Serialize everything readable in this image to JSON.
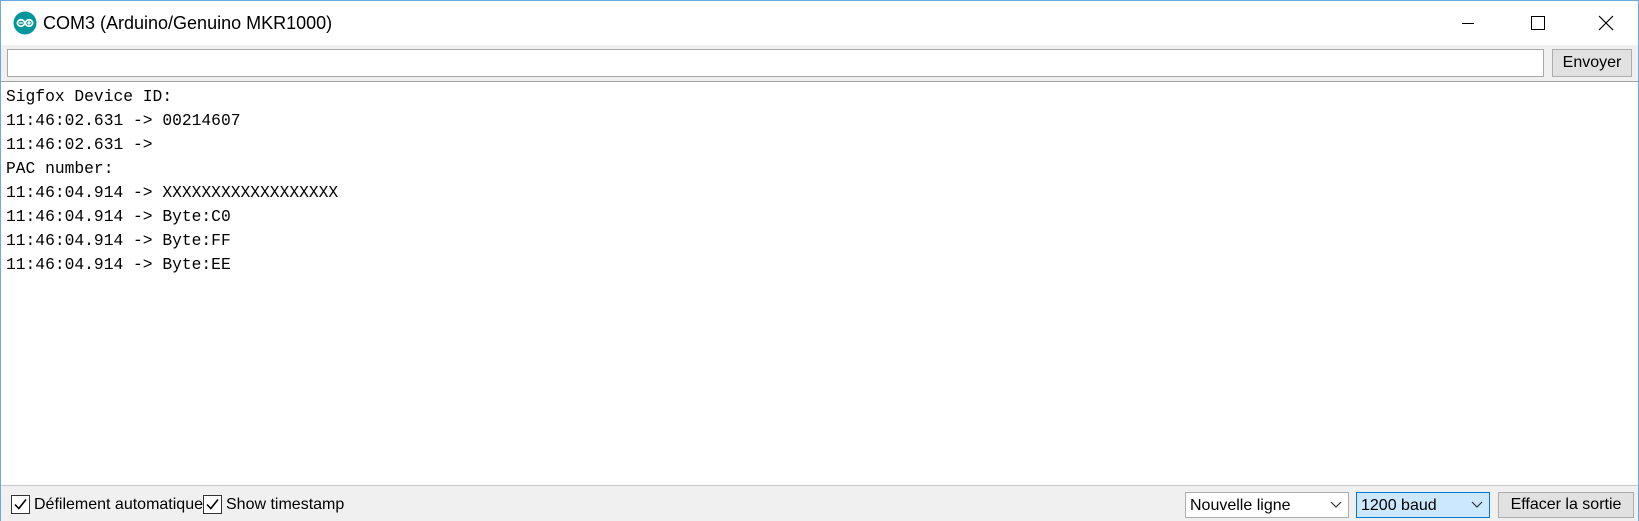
{
  "window": {
    "title": "COM3 (Arduino/Genuino MKR1000)",
    "icon": "arduino-logo-icon",
    "controls": [
      "minimize-icon",
      "maximize-icon",
      "close-icon"
    ]
  },
  "send": {
    "input_value": "",
    "button_label": "Envoyer"
  },
  "output": {
    "lines": [
      "Sigfox Device ID:",
      "11:46:02.631 -> 00214607",
      "11:46:02.631 -> ",
      "PAC number:",
      "11:46:04.914 -> XXXXXXXXXXXXXXXXXX",
      "11:46:04.914 -> Byte:C0",
      "11:46:04.914 -> Byte:FF",
      "11:46:04.914 -> Byte:EE"
    ]
  },
  "bottom": {
    "autoscroll": {
      "label": "Défilement automatique",
      "checked": true
    },
    "timestamp": {
      "label": "Show timestamp",
      "checked": true
    },
    "line_ending": {
      "selected": "Nouvelle ligne"
    },
    "baud_rate": {
      "selected": "1200 baud"
    },
    "clear_label": "Effacer la sortie"
  },
  "colors": {
    "arduino_teal": "#00979c",
    "window_border": "#6fa8dc",
    "selected_select_bg": "#cce8ff",
    "selected_select_border": "#0078d7"
  }
}
